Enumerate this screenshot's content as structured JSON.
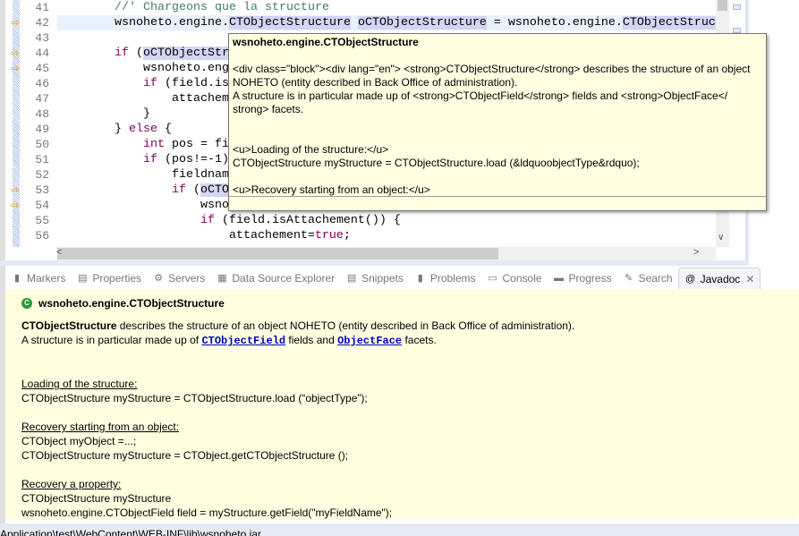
{
  "editor": {
    "current_line": 42,
    "marker_lines": [
      42,
      44,
      45,
      53,
      54
    ],
    "lines": [
      {
        "num": "41",
        "segs": [
          [
            "        ",
            ""
          ],
          [
            "//' Chargeons que la structure",
            "cm"
          ]
        ]
      },
      {
        "num": "42",
        "segs": [
          [
            "        wsnoheto.engine.",
            ""
          ],
          [
            "CTObjectStructure",
            "hl"
          ],
          [
            " ",
            ""
          ],
          [
            "oCTObjectStructure",
            "hl"
          ],
          [
            " = wsnoheto.engine.",
            ""
          ],
          [
            "CTObjectStruc",
            "hl"
          ]
        ]
      },
      {
        "num": "43",
        "segs": []
      },
      {
        "num": "44",
        "segs": [
          [
            "        ",
            ""
          ],
          [
            "if",
            "kw"
          ],
          [
            " (",
            ""
          ],
          [
            "oCTObjectStr",
            "hl"
          ]
        ]
      },
      {
        "num": "45",
        "segs": [
          [
            "            wsnoheto.eng",
            ""
          ]
        ]
      },
      {
        "num": "46",
        "segs": [
          [
            "            ",
            ""
          ],
          [
            "if",
            "kw"
          ],
          [
            " (field.is",
            ""
          ]
        ]
      },
      {
        "num": "47",
        "segs": [
          [
            "                attachem",
            ""
          ]
        ]
      },
      {
        "num": "48",
        "segs": [
          [
            "            }",
            ""
          ]
        ]
      },
      {
        "num": "49",
        "segs": [
          [
            "        } ",
            ""
          ],
          [
            "else",
            "kw"
          ],
          [
            " {",
            ""
          ]
        ]
      },
      {
        "num": "50",
        "segs": [
          [
            "            ",
            ""
          ],
          [
            "int",
            "kw"
          ],
          [
            " pos = fi",
            ""
          ]
        ]
      },
      {
        "num": "51",
        "segs": [
          [
            "            ",
            ""
          ],
          [
            "if",
            "kw"
          ],
          [
            " (pos!=-1)",
            ""
          ]
        ]
      },
      {
        "num": "52",
        "segs": [
          [
            "                fieldnam",
            ""
          ]
        ]
      },
      {
        "num": "53",
        "segs": [
          [
            "                ",
            ""
          ],
          [
            "if",
            "kw"
          ],
          [
            " (",
            ""
          ],
          [
            "oCTO",
            "hl"
          ]
        ]
      },
      {
        "num": "54",
        "segs": [
          [
            "                    wsno",
            ""
          ]
        ]
      },
      {
        "num": "55",
        "segs": [
          [
            "                    ",
            ""
          ],
          [
            "if",
            "kw"
          ],
          [
            " (field.isAttachement()) {",
            ""
          ]
        ]
      },
      {
        "num": "56",
        "segs": [
          [
            "                        attachement=",
            ""
          ],
          [
            "true",
            "kw"
          ],
          [
            ";",
            ""
          ]
        ]
      }
    ]
  },
  "tooltip": {
    "title": "wsnoheto.engine.CTObjectStructure",
    "lines": [
      "<div class=\"block\"><div lang=\"en\"> <strong>CTObjectStructure</strong> describes the structure of an object",
      " NOHETO (entity described in Back Office of administration).",
      "A structure is in particular made up of <strong>CTObjectField</strong> fields and <strong>ObjectFace</",
      " strong> facets.",
      "",
      "",
      "<u>Loading of the structure:</u>",
      "CTObjectStructure myStructure = CTObjectStructure.load (&ldquoobjectType&rdquo);",
      "",
      "<u>Recovery starting from an object:</u>"
    ]
  },
  "tabs": [
    {
      "label": "Markers",
      "icon": "markers-icon",
      "glyph": "▮"
    },
    {
      "label": "Properties",
      "icon": "properties-icon",
      "glyph": "▤"
    },
    {
      "label": "Servers",
      "icon": "servers-icon",
      "glyph": "⚙"
    },
    {
      "label": "Data Source Explorer",
      "icon": "data-source-icon",
      "glyph": "▦"
    },
    {
      "label": "Snippets",
      "icon": "snippets-icon",
      "glyph": "▤"
    },
    {
      "label": "Problems",
      "icon": "problems-icon",
      "glyph": "▮"
    },
    {
      "label": "Console",
      "icon": "console-icon",
      "glyph": "▭"
    },
    {
      "label": "Progress",
      "icon": "progress-icon",
      "glyph": "▬"
    },
    {
      "label": "Search",
      "icon": "search-icon",
      "glyph": "✎"
    },
    {
      "label": "Javadoc",
      "icon": "javadoc-icon",
      "glyph": "@",
      "active": true
    }
  ],
  "javadoc": {
    "class_name": "wsnoheto.engine.CTObjectStructure",
    "desc_bold": "CTObjectStructure",
    "desc_rest": " describes the structure of an object NOHETO (entity described in Back Office of administration).",
    "line2_a": "A structure is in particular made up of ",
    "link1": "CTObjectField",
    "line2_b": " fields and ",
    "link2": "ObjectFace",
    "line2_c": " facets.",
    "loading_heading": "Loading of the structure:",
    "loading_code": "CTObjectStructure myStructure = CTObjectStructure.load (“objectType”);",
    "recovery_heading": "Recovery starting from an object:",
    "recovery_code1": "CTObject myObject =...;",
    "recovery_code2": "CTObjectStructure myStructure = CTObject.getCTObjectStructure ();",
    "property_heading": "Recovery a property:",
    "property_code1": "CTObjectStructure myStructure",
    "property_code2": "wsnoheto.engine.CTObjectField field = myStructure.getField(\"myFieldName\");"
  },
  "status": {
    "path": "Application\\test\\WebContent\\WEB-INF\\lib\\wsnoheto.jar"
  }
}
